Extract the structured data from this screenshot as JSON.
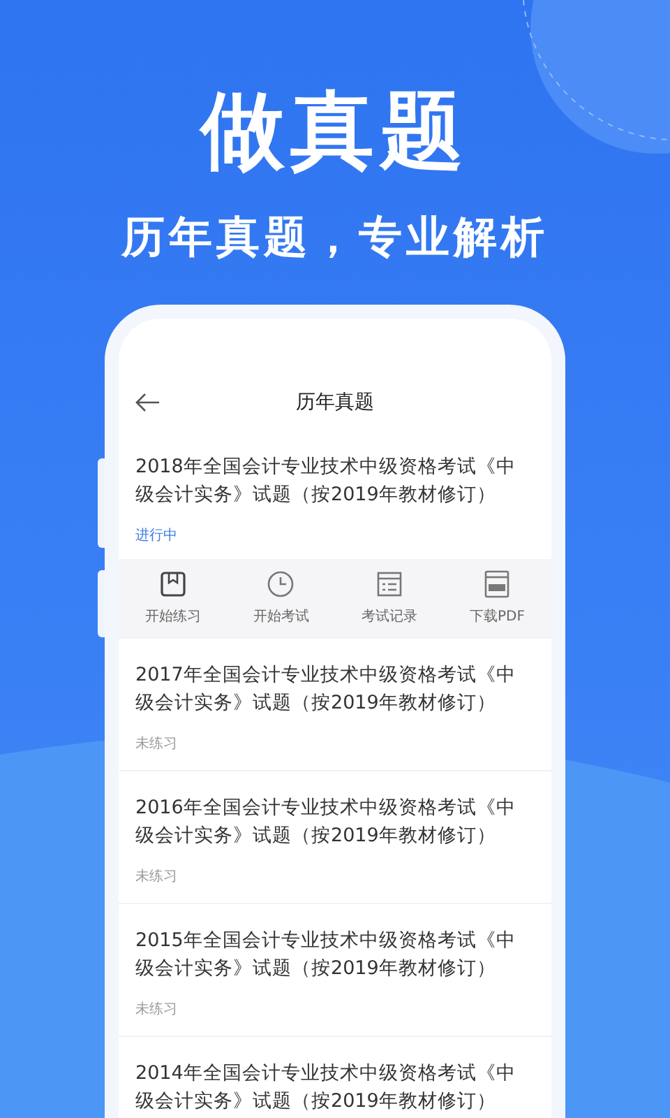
{
  "headline": "做真题",
  "subheadline": "历年真题，专业解析",
  "screen": {
    "title": "历年真题",
    "papers": [
      {
        "title": "2018年全国会计专业技术中级资格考试《中级会计实务》试题（按2019年教材修订）",
        "status": {
          "text": "进行中",
          "kind": "in_progress"
        },
        "actions": [
          "开始练习",
          "开始考试",
          "考试记录",
          "下载PDF"
        ]
      },
      {
        "title": "2017年全国会计专业技术中级资格考试《中级会计实务》试题（按2019年教材修订）",
        "status": {
          "text": "未练习",
          "kind": "not_started"
        }
      },
      {
        "title": "2016年全国会计专业技术中级资格考试《中级会计实务》试题（按2019年教材修订）",
        "status": {
          "text": "未练习",
          "kind": "not_started"
        }
      },
      {
        "title": "2015年全国会计专业技术中级资格考试《中级会计实务》试题（按2019年教材修订）",
        "status": {
          "text": "未练习",
          "kind": "not_started"
        }
      },
      {
        "title": "2014年全国会计专业技术中级资格考试《中级会计实务》试题（按2019年教材修订）"
      }
    ]
  }
}
